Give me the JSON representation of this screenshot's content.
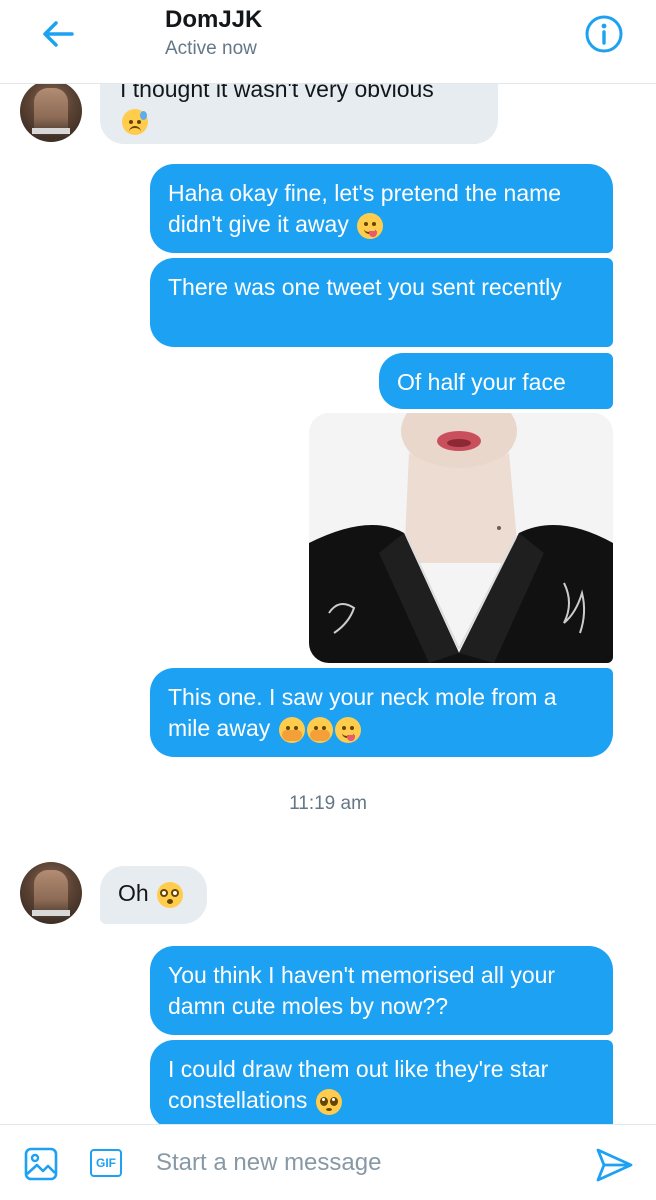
{
  "header": {
    "title": "DomJJK",
    "status": "Active now"
  },
  "messages": [
    {
      "side": "in",
      "text": "I thought it wasn't very obvious",
      "emoji": [
        "downcast-sweat"
      ]
    },
    {
      "side": "out",
      "text": "Haha okay fine, let's pretend the name didn't give it away",
      "emoji": [
        "yum"
      ]
    },
    {
      "side": "out",
      "text": "There was one tweet you sent recently"
    },
    {
      "side": "out",
      "text": "Of half your face"
    },
    {
      "side": "out",
      "type": "photo"
    },
    {
      "side": "out",
      "text": "This one. I saw your neck mole from a mile away",
      "emoji": [
        "hand-over-mouth",
        "hand-over-mouth",
        "yum"
      ]
    },
    {
      "side": "in",
      "text": "Oh",
      "emoji": [
        "flushed"
      ]
    },
    {
      "side": "out",
      "text": "You think I haven't memorised all your damn cute moles by now??"
    },
    {
      "side": "out",
      "text": "I could draw them out like they're star constellations",
      "emoji": [
        "pleading"
      ]
    }
  ],
  "timestamp": "11:19 am",
  "composer": {
    "placeholder": "Start a new message",
    "gif_label": "GIF"
  },
  "icons": {
    "back": "arrow-left-icon",
    "info": "info-icon",
    "image": "image-icon",
    "gif": "gif-icon",
    "send": "send-icon"
  },
  "colors": {
    "accent": "#1da1f2",
    "incoming_bubble": "#e6ecf0",
    "muted_text": "#657786"
  }
}
